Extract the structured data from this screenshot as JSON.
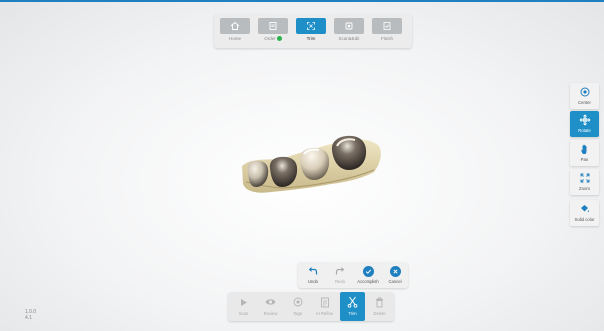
{
  "steps": [
    {
      "label": "Home",
      "icon": "home-icon"
    },
    {
      "label": "Order",
      "icon": "order-icon",
      "checked": true
    },
    {
      "label": "Trim",
      "icon": "trim-icon",
      "active": true
    },
    {
      "label": "Scan&Edit",
      "icon": "scan-edit-icon"
    },
    {
      "label": "Finish",
      "icon": "finish-icon"
    }
  ],
  "right_tools": [
    {
      "label": "Center",
      "icon": "center-icon"
    },
    {
      "label": "Rotate",
      "icon": "rotate-icon",
      "active": true
    },
    {
      "label": "Pan",
      "icon": "hand-icon"
    },
    {
      "label": "Zoom",
      "icon": "zoom-icon"
    },
    {
      "label": "Solid color",
      "icon": "solid-color-icon"
    }
  ],
  "edit_actions": [
    {
      "label": "Undo",
      "icon": "undo-icon"
    },
    {
      "label": "Redo",
      "icon": "redo-icon"
    },
    {
      "label": "Accomplish",
      "icon": "check-icon"
    },
    {
      "label": "Cancel",
      "icon": "cancel-icon"
    }
  ],
  "bottom_tools": [
    {
      "label": "Scan",
      "icon": "play-icon"
    },
    {
      "label": "Review",
      "icon": "eye-icon"
    },
    {
      "label": "Tags",
      "icon": "tag-icon"
    },
    {
      "label": "AI Refine",
      "icon": "refine-icon"
    },
    {
      "label": "Trim",
      "icon": "scissors-icon",
      "active": true
    },
    {
      "label": "Delete",
      "icon": "trash-icon"
    }
  ],
  "version": {
    "line1": "1.0.0",
    "line2": "4.1"
  },
  "colors": {
    "accent": "#1f8fc8",
    "check": "#27b24a",
    "inactive": "#b9bcbf"
  }
}
